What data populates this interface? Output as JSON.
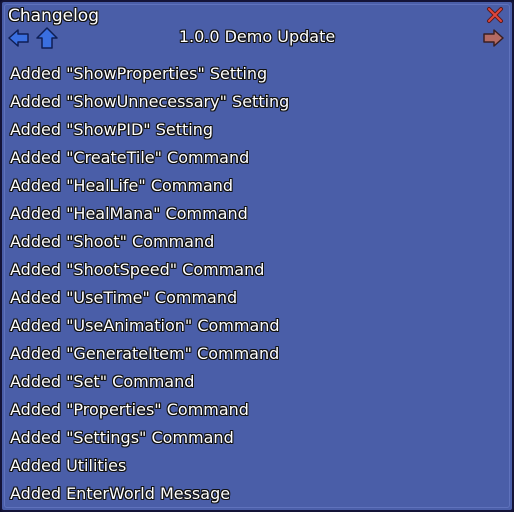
{
  "window": {
    "title": "Changelog",
    "close_icon": "close-x-icon",
    "close_color": "#e0463c"
  },
  "nav": {
    "prev_icon": "arrow-left-icon",
    "up_icon": "arrow-up-icon",
    "next_icon": "arrow-right-icon",
    "active_color": "#3a6fe0",
    "inactive_color": "#b46a63"
  },
  "version_title": "1.0.0 Demo Update",
  "entries": [
    "Added \"ShowProperties\" Setting",
    "Added \"ShowUnnecessary\" Setting",
    "Added \"ShowPID\" Setting",
    "Added \"CreateTile\" Command",
    "Added \"HealLife\" Command",
    "Added \"HealMana\" Command",
    "Added \"Shoot\" Command",
    "Added \"ShootSpeed\" Command",
    "Added \"UseTime\" Command",
    "Added \"UseAnimation\" Command",
    "Added \"GenerateItem\" Command",
    "Added \"Set\" Command",
    "Added \"Properties\" Command",
    "Added \"Settings\" Command",
    "Added Utilities",
    "Added EnterWorld Message"
  ]
}
